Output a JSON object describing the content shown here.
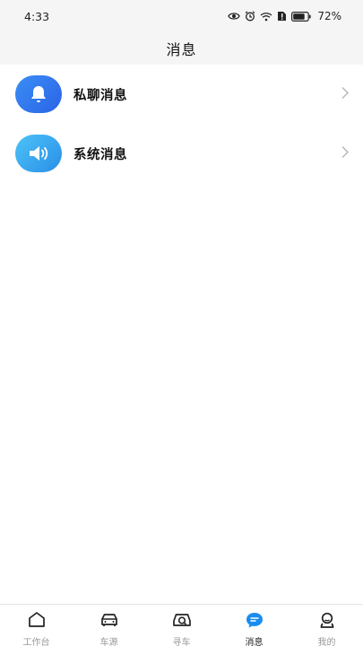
{
  "status_bar": {
    "time": "4:33",
    "battery": "72%"
  },
  "header": {
    "title": "消息"
  },
  "messages": [
    {
      "label": "私聊消息",
      "icon": "bell-icon",
      "color": "#2f6fec"
    },
    {
      "label": "系统消息",
      "icon": "speaker-icon",
      "color": "#35a6f0"
    }
  ],
  "tabs": [
    {
      "label": "工作台",
      "icon": "home-icon",
      "active": false
    },
    {
      "label": "车源",
      "icon": "car-icon",
      "active": false
    },
    {
      "label": "寻车",
      "icon": "car-search-icon",
      "active": false
    },
    {
      "label": "消息",
      "icon": "chat-icon",
      "active": true
    },
    {
      "label": "我的",
      "icon": "user-icon",
      "active": false
    }
  ],
  "colors": {
    "accent": "#1a8cf0",
    "inactive_tab": "#999999",
    "background": "#f5f5f5"
  }
}
